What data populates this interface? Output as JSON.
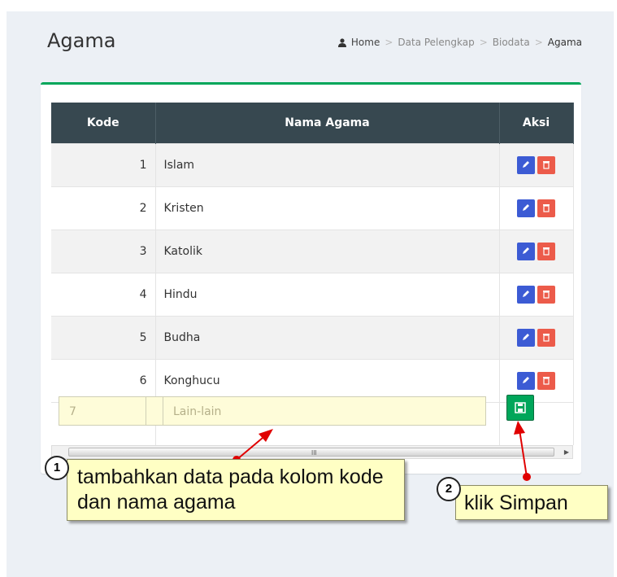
{
  "page": {
    "title": "Agama",
    "breadcrumb": [
      "Home",
      "Data Pelengkap",
      "Biodata",
      "Agama"
    ],
    "breadcrumb_separator": ">"
  },
  "table": {
    "columns": [
      "Kode",
      "Nama Agama",
      "Aksi"
    ],
    "rows": [
      {
        "kode": "1",
        "nama": "Islam"
      },
      {
        "kode": "2",
        "nama": "Kristen"
      },
      {
        "kode": "3",
        "nama": "Katolik"
      },
      {
        "kode": "4",
        "nama": "Hindu"
      },
      {
        "kode": "5",
        "nama": "Budha"
      },
      {
        "kode": "6",
        "nama": "Konghucu"
      }
    ],
    "row_actions": [
      "pencil-icon",
      "trash-icon"
    ]
  },
  "new_row": {
    "kode_value": "7",
    "nama_placeholder": "Lain-lain"
  },
  "scrollbar_grip": "III",
  "annotations": {
    "step1_number": "1",
    "step1_text": "tambahkan data pada kolom kode dan nama agama",
    "step2_number": "2",
    "step2_text": "klik Simpan"
  },
  "colors": {
    "accent_green": "#00a65a",
    "header_dark": "#374850",
    "edit_blue": "#3c5bd4",
    "delete_red": "#ec5b4a",
    "callout_yellow": "#ffffc4",
    "arrow_red": "#e00000"
  }
}
